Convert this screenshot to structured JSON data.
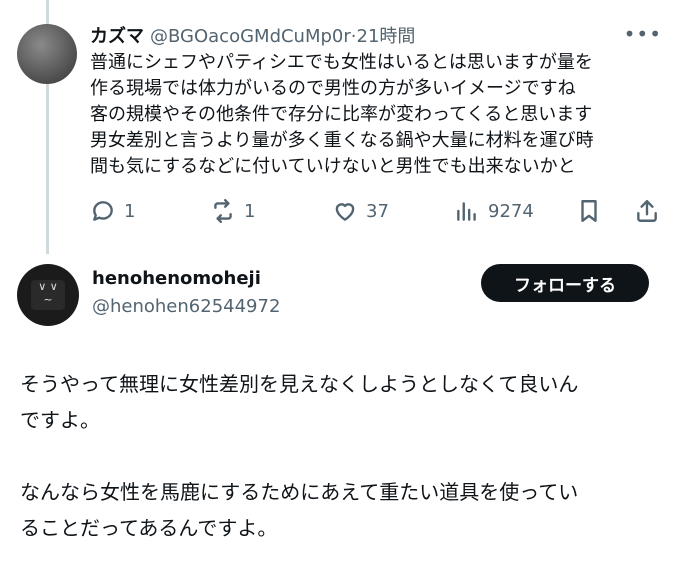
{
  "reply": {
    "name": "カズマ",
    "handle": "@BGOacoGMdCuMp0r",
    "separator": "·",
    "time": "21時間",
    "lines": [
      "普通にシェフやパティシエでも女性はいるとは思いますが量を",
      "作る現場では体力がいるので男性の方が多いイメージですね",
      "客の規模やその他条件で存分に比率が変わってくると思います",
      "男女差別と言うより量が多く重くなる鍋や大量に材料を運び時",
      "間も気にするなどに付いていけないと男性でも出来ないかと"
    ],
    "actions": {
      "replies": "1",
      "reposts": "1",
      "likes": "37",
      "views": "9274"
    }
  },
  "main": {
    "name": "henohenomoheji",
    "handle": "@henohen62544972",
    "follow_label": "フォローする",
    "paragraph1": [
      "そうやって無理に女性差別を見えなくしようとしなくて良いん",
      "ですよ。"
    ],
    "paragraph2": [
      "なんなら女性を馬鹿にするためにあえて重たい道具を使ってい",
      "ることだってあるんですよ。"
    ]
  },
  "colors": {
    "text": "#0f1419",
    "secondary": "#536471",
    "follow_bg": "#0f1419",
    "thread_line": "#cfd9de"
  },
  "icons": [
    "reply-icon",
    "repost-icon",
    "like-icon",
    "views-icon",
    "bookmark-icon",
    "share-icon",
    "more-icon"
  ]
}
